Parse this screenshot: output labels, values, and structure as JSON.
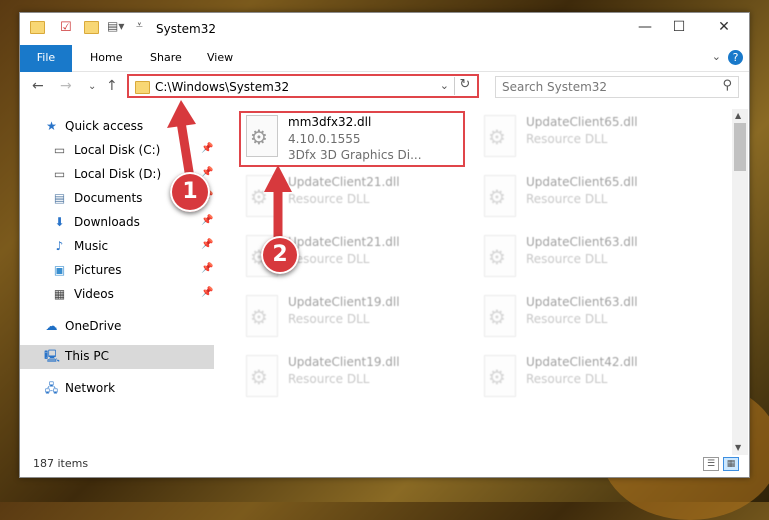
{
  "window": {
    "title": "System32"
  },
  "controls": {
    "minimize": "—",
    "maximize": "☐",
    "close": "✕"
  },
  "ribbon": {
    "tabs": [
      "File",
      "Home",
      "Share",
      "View"
    ],
    "help": "?"
  },
  "address": {
    "path": "C:\\Windows\\System32",
    "refresh": "↻",
    "dropdown": "⌄"
  },
  "search": {
    "placeholder": "Search System32"
  },
  "sidebar": {
    "items": [
      {
        "label": "Quick access",
        "icon": "star-icon",
        "pinned": false
      },
      {
        "label": "Local Disk (C:)",
        "icon": "drive-icon",
        "pinned": true
      },
      {
        "label": "Local Disk (D:)",
        "icon": "drive-icon",
        "pinned": true
      },
      {
        "label": "Documents",
        "icon": "documents-icon",
        "pinned": true
      },
      {
        "label": "Downloads",
        "icon": "download-icon",
        "pinned": true
      },
      {
        "label": "Music",
        "icon": "music-icon",
        "pinned": true
      },
      {
        "label": "Pictures",
        "icon": "pictures-icon",
        "pinned": true
      },
      {
        "label": "Videos",
        "icon": "videos-icon",
        "pinned": true
      },
      {
        "label": "OneDrive",
        "icon": "cloud-icon",
        "pinned": false
      },
      {
        "label": "This PC",
        "icon": "computer-icon",
        "pinned": false
      },
      {
        "label": "Network",
        "icon": "network-icon",
        "pinned": false
      }
    ],
    "selected": "This PC"
  },
  "files": [
    {
      "name": "mm3dfx32.dll",
      "line2": "4.10.0.1555",
      "line3": "3Dfx 3D Graphics Di...",
      "highlighted": true
    },
    {
      "name": "UpdateClient65.dll",
      "line2": "Resource DLL"
    },
    {
      "name": "UpdateClient21.dll",
      "line2": "Resource DLL"
    },
    {
      "name": "UpdateClient65.dll",
      "line2": "Resource DLL"
    },
    {
      "name": "UpdateClient21.dll",
      "line2": "Resource DLL"
    },
    {
      "name": "UpdateClient63.dll",
      "line2": "Resource DLL"
    },
    {
      "name": "UpdateClient19.dll",
      "line2": "Resource DLL"
    },
    {
      "name": "UpdateClient63.dll",
      "line2": "Resource DLL"
    },
    {
      "name": "UpdateClient19.dll",
      "line2": "Resource DLL"
    },
    {
      "name": "UpdateClient42.dll",
      "line2": "Resource DLL"
    }
  ],
  "status": {
    "count": "187 items"
  },
  "callouts": [
    "1",
    "2"
  ],
  "colors": {
    "accent": "#1979ca",
    "highlight": "#e0454a",
    "callout": "#d7393d"
  }
}
